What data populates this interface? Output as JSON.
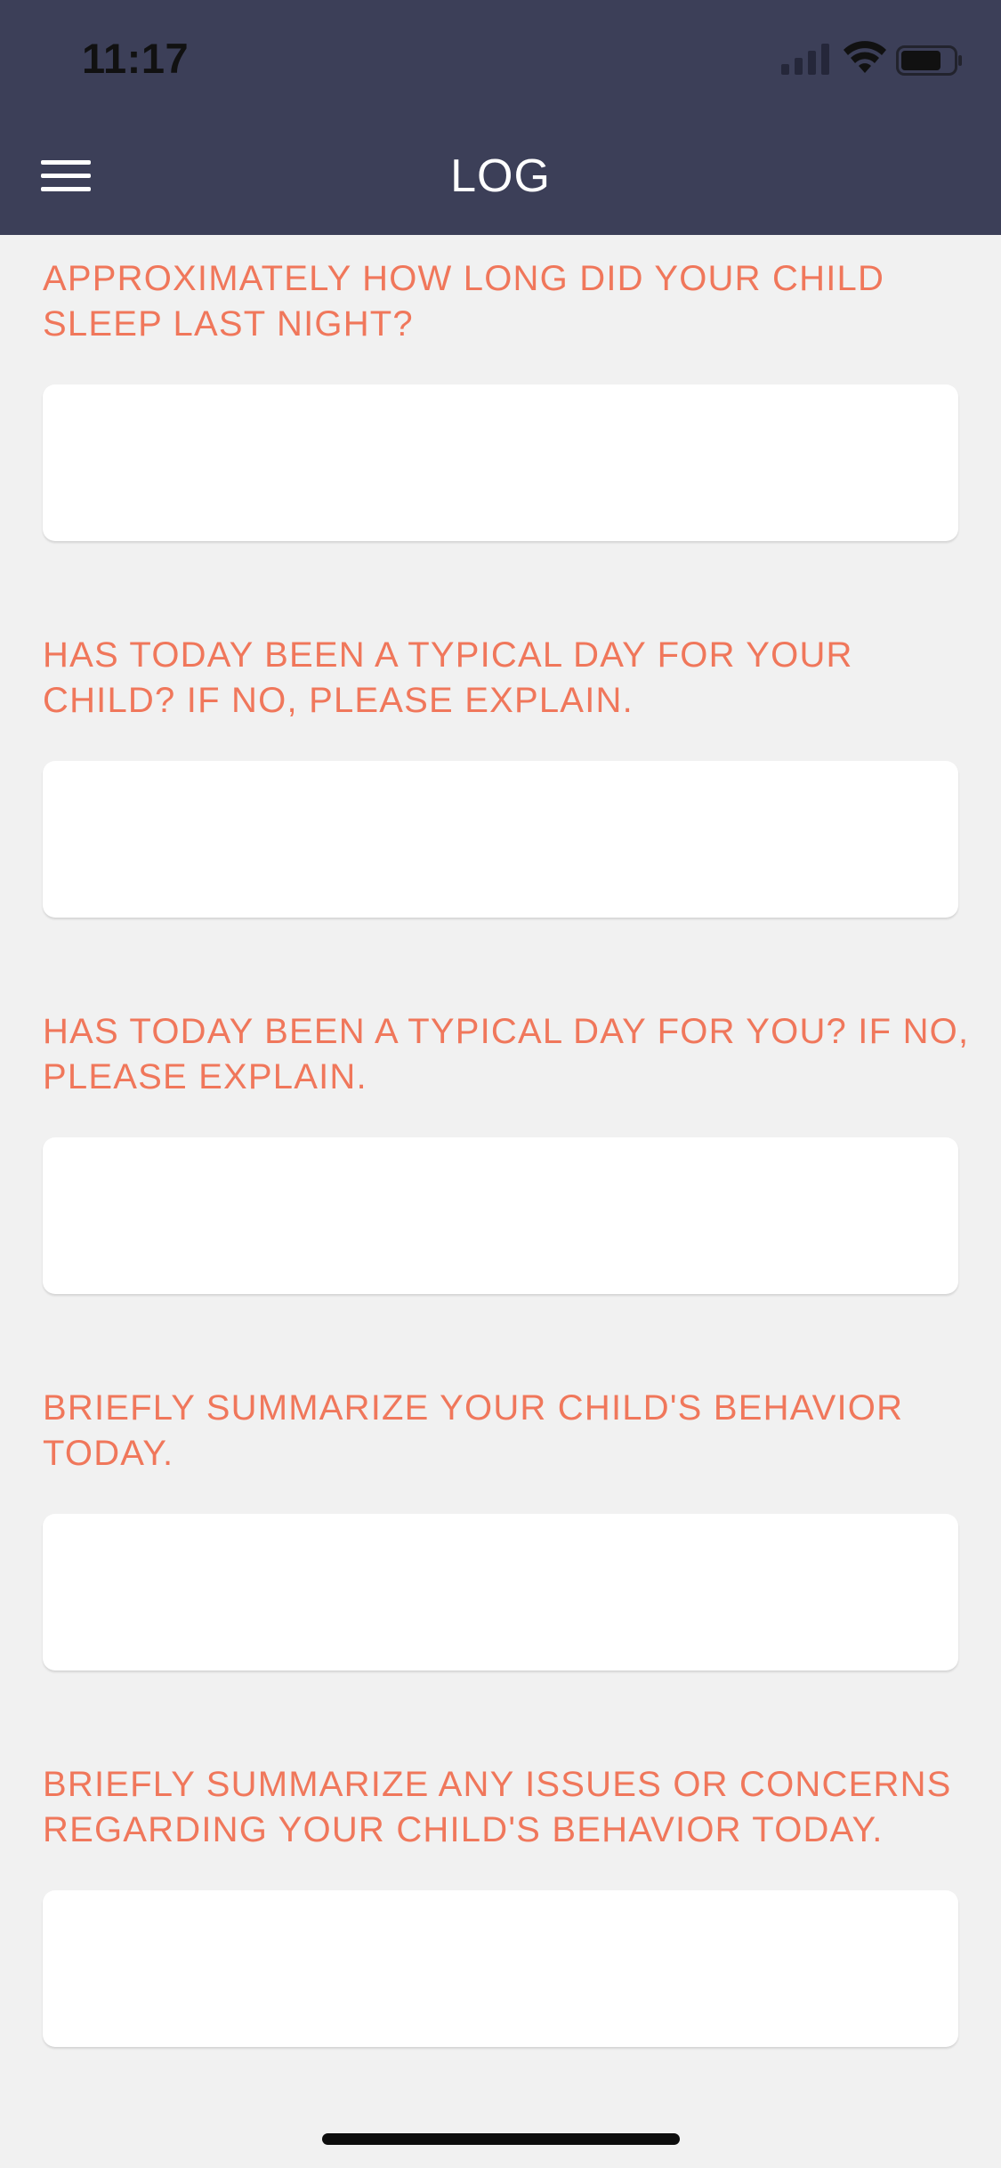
{
  "status_bar": {
    "time": "11:17"
  },
  "nav": {
    "title": "LOG",
    "menu_icon": "hamburger-menu-icon"
  },
  "form": {
    "questions": [
      {
        "label": "APPROXIMATELY HOW LONG DID YOUR CHILD SLEEP LAST NIGHT?",
        "value": "",
        "placeholder": ""
      },
      {
        "label": "HAS TODAY BEEN A TYPICAL DAY FOR YOUR CHILD? IF NO, PLEASE EXPLAIN.",
        "value": "",
        "placeholder": ""
      },
      {
        "label": "HAS TODAY BEEN A TYPICAL DAY FOR YOU? IF NO, PLEASE EXPLAIN.",
        "value": "",
        "placeholder": ""
      },
      {
        "label": "BRIEFLY SUMMARIZE YOUR CHILD'S BEHAVIOR TODAY.",
        "value": "",
        "placeholder": ""
      },
      {
        "label": "BRIEFLY SUMMARIZE ANY ISSUES OR CONCERNS REGARDING YOUR CHILD'S BEHAVIOR TODAY.",
        "value": "",
        "placeholder": ""
      }
    ]
  },
  "colors": {
    "header_bg": "#3c3f58",
    "label": "#f0775b",
    "page_bg": "#f1f1f1"
  }
}
